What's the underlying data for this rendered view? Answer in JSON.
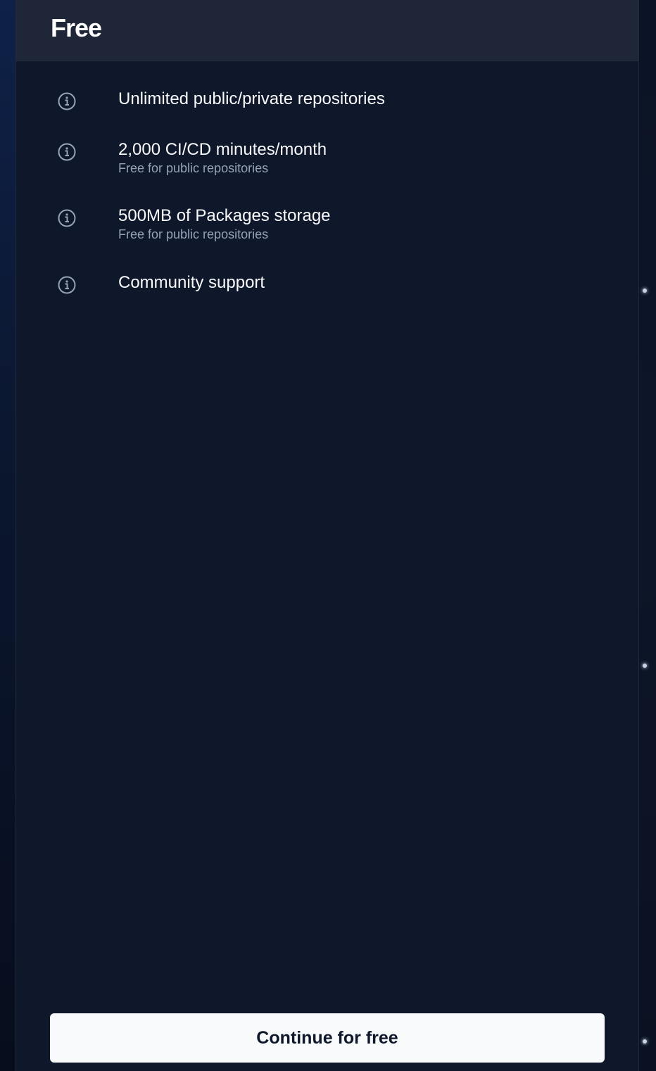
{
  "plan": {
    "title": "Free",
    "features": [
      {
        "label": "Unlimited public/private repositories",
        "sub": "",
        "icon": "info-icon"
      },
      {
        "label": "2,000 CI/CD minutes/month",
        "sub": "Free for public repositories",
        "icon": "info-icon"
      },
      {
        "label": "500MB of Packages storage",
        "sub": "Free for public repositories",
        "icon": "info-icon"
      },
      {
        "label": "Community support",
        "sub": "",
        "icon": "info-icon"
      }
    ],
    "cta_label": "Continue for free"
  },
  "colors": {
    "card_bg": "#0f172a",
    "header_bg": "#1e2637",
    "button_bg": "#f8fafc",
    "muted_text": "#94a3b8"
  }
}
